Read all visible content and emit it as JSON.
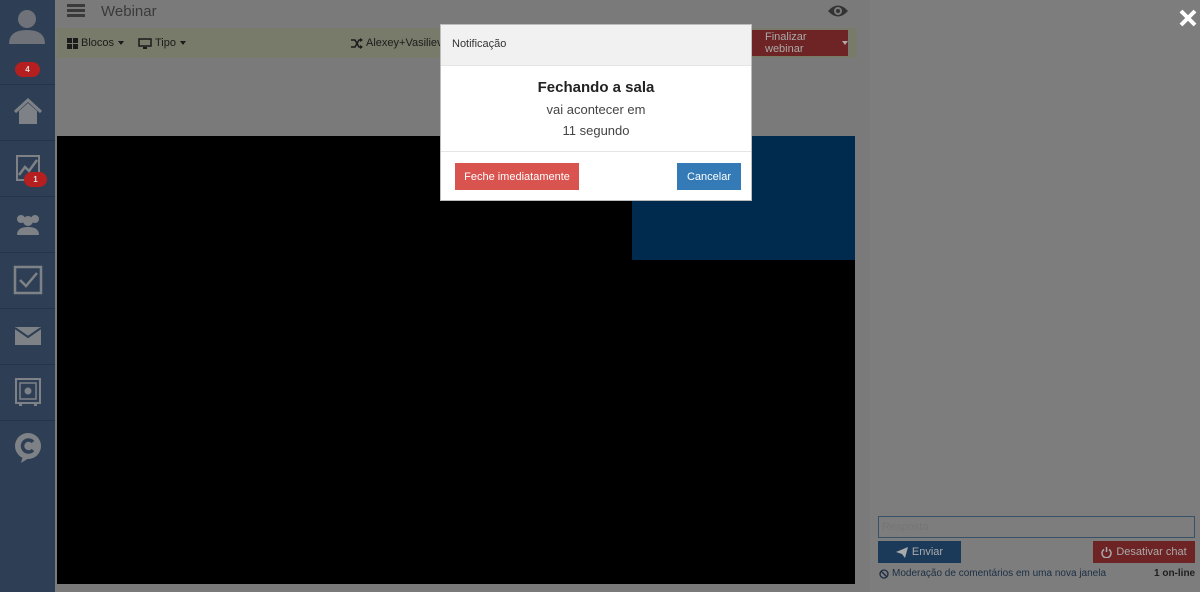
{
  "header": {
    "title": "Webinar"
  },
  "sidebar": {
    "notification_count": "4",
    "stats_badge": "1",
    "items": [
      {
        "icon": "home-icon"
      },
      {
        "icon": "chart-icon"
      },
      {
        "icon": "users-icon"
      },
      {
        "icon": "checkbox-icon"
      },
      {
        "icon": "mail-icon"
      },
      {
        "icon": "safe-icon"
      },
      {
        "icon": "chat-logo-icon"
      }
    ]
  },
  "toolbar": {
    "blocks_label": "Blocos",
    "type_label": "Tipo",
    "participant_label": "Alexey+Vasiliev",
    "finish_label": "Finalizar webinar"
  },
  "modal": {
    "header": "Notificação",
    "title": "Fechando a sala",
    "line1": "vai acontecer em",
    "line2": "11 segundo",
    "close_now_label": "Feche imediatamente",
    "cancel_label": "Cancelar"
  },
  "chat": {
    "input_placeholder": "Resposta",
    "send_label": "Enviar",
    "disable_label": "Desativar chat",
    "moderation_text": "Moderação de comentários em uma nova janela",
    "online_text": "1 on-line"
  },
  "colors": {
    "overlay": "#7a7a7a",
    "sidebar": "#2e3f55",
    "danger": "#d9534f",
    "primary": "#337ab7"
  }
}
